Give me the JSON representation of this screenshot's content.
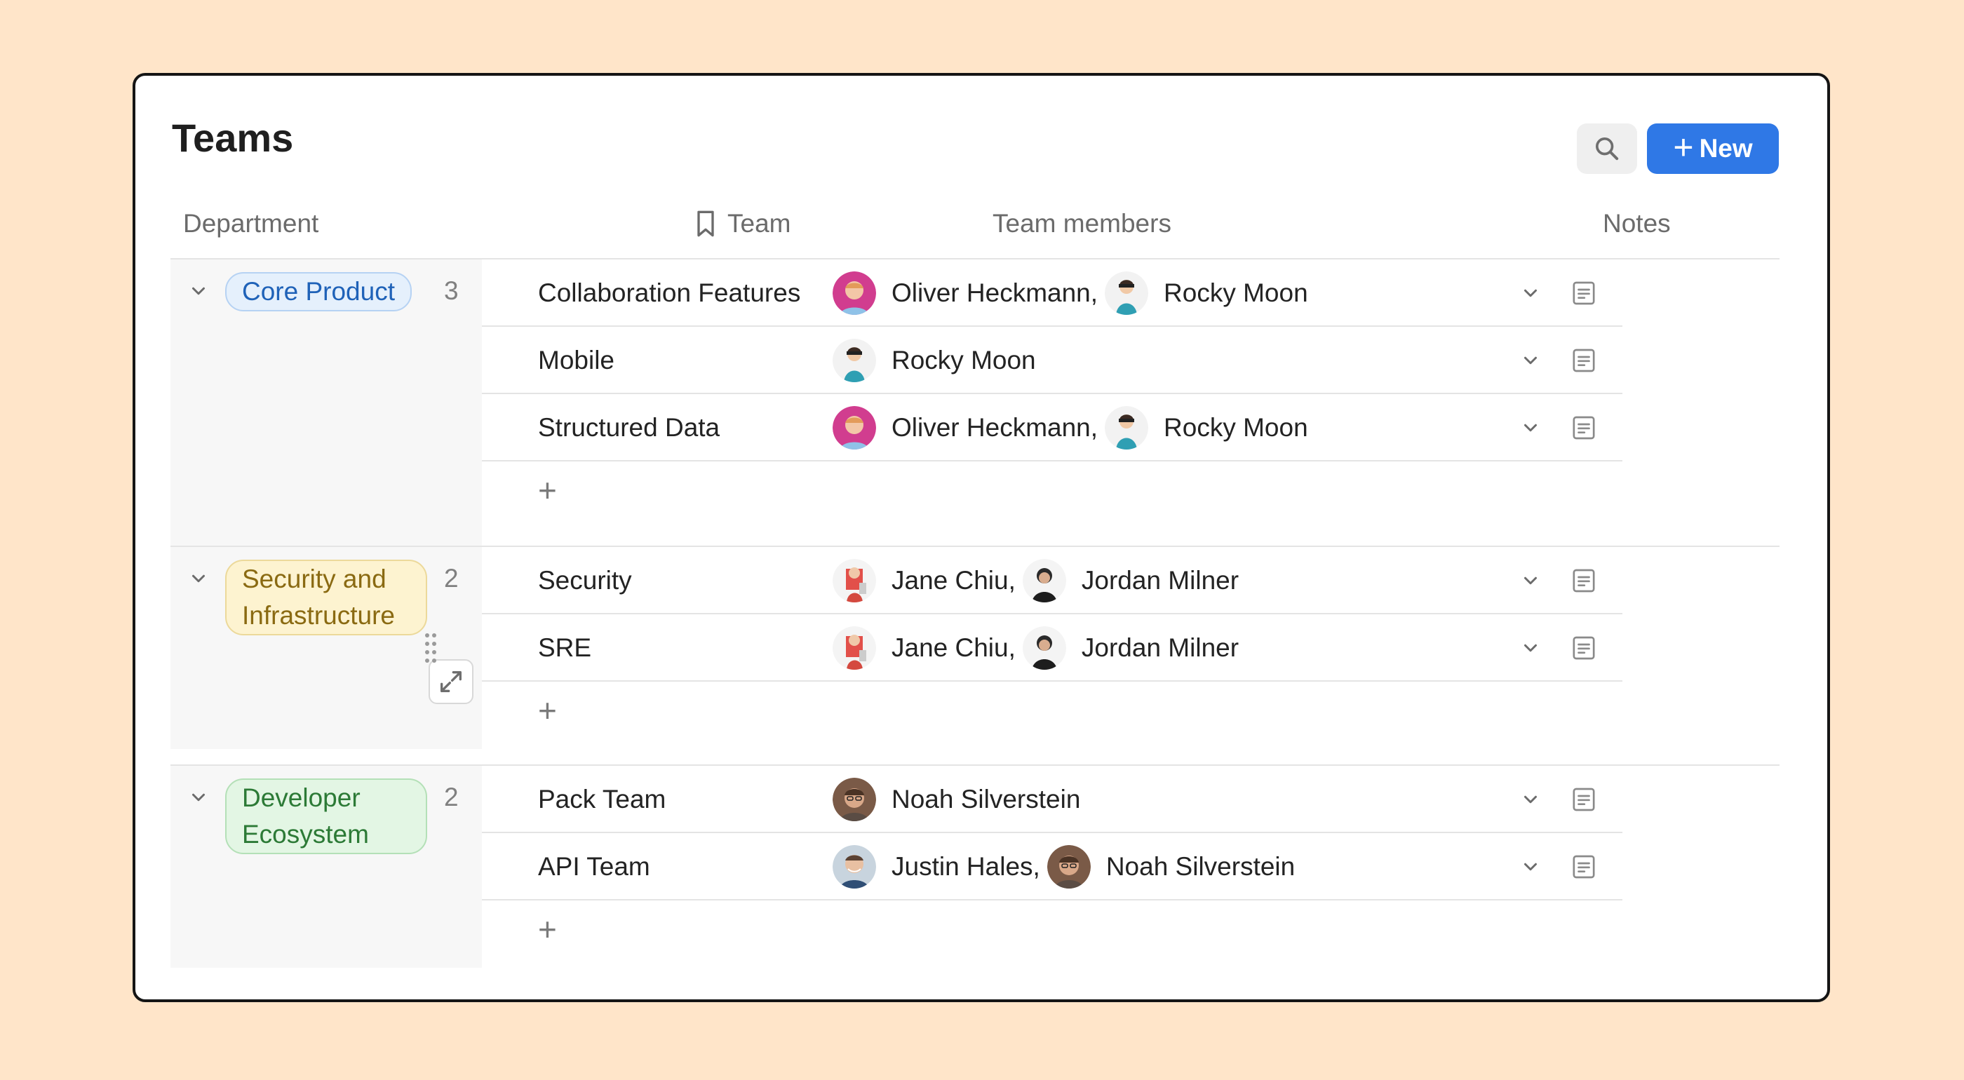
{
  "page": {
    "title": "Teams"
  },
  "toolbar": {
    "search_icon": "search-icon",
    "new_label": "New",
    "new_icon": "plus-icon",
    "accent_color": "#2f78e6"
  },
  "columns": {
    "department": "Department",
    "team": "Team",
    "team_icon": "bookmark-icon",
    "members": "Team members",
    "notes": "Notes"
  },
  "groups": [
    {
      "department": "Core Product",
      "count": "3",
      "tag_color": "#e5f0fc",
      "teams": [
        {
          "name": "Collaboration Features",
          "members": [
            {
              "name": "Oliver Heckmann,",
              "avatar": "avatar-oliver-heckmann"
            },
            {
              "name": "Rocky Moon",
              "avatar": "avatar-rocky-moon"
            }
          ]
        },
        {
          "name": "Mobile",
          "members": [
            {
              "name": "Rocky Moon",
              "avatar": "avatar-rocky-moon"
            }
          ]
        },
        {
          "name": "Structured Data",
          "members": [
            {
              "name": "Oliver Heckmann,",
              "avatar": "avatar-oliver-heckmann"
            },
            {
              "name": "Rocky Moon",
              "avatar": "avatar-rocky-moon"
            }
          ]
        }
      ],
      "add_label": "+"
    },
    {
      "department": "Security and Infrastructure",
      "count": "2",
      "tag_color": "#fdf3d0",
      "teams": [
        {
          "name": "Security",
          "members": [
            {
              "name": "Jane Chiu,",
              "avatar": "avatar-jane-chiu"
            },
            {
              "name": "Jordan Milner",
              "avatar": "avatar-jordan-milner"
            }
          ]
        },
        {
          "name": "SRE",
          "members": [
            {
              "name": "Jane Chiu,",
              "avatar": "avatar-jane-chiu"
            },
            {
              "name": "Jordan Milner",
              "avatar": "avatar-jordan-milner"
            }
          ]
        }
      ],
      "add_label": "+"
    },
    {
      "department": "Developer Ecosystem",
      "count": "2",
      "tag_color": "#e3f6e4",
      "teams": [
        {
          "name": "Pack Team",
          "members": [
            {
              "name": "Noah Silverstein",
              "avatar": "avatar-noah-silverstein"
            }
          ]
        },
        {
          "name": "API Team",
          "members": [
            {
              "name": "Justin Hales,",
              "avatar": "avatar-justin-hales"
            },
            {
              "name": "Noah Silverstein",
              "avatar": "avatar-noah-silverstein"
            }
          ]
        }
      ],
      "add_label": "+"
    }
  ],
  "row_icons": {
    "expand": "chevron-down-icon",
    "notes": "note-icon",
    "open": "expand-icon",
    "drag": "drag-handle-icon"
  }
}
